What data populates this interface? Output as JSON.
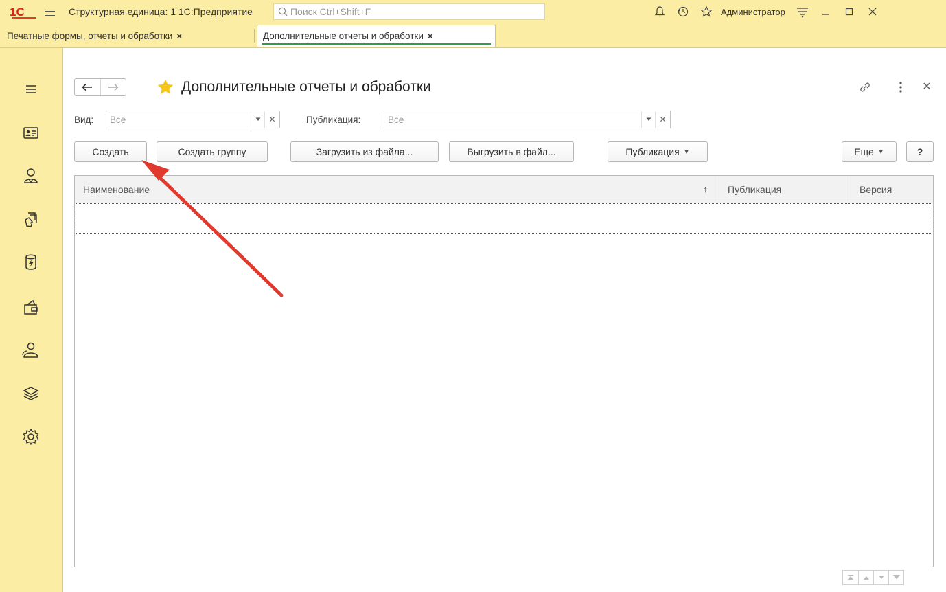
{
  "titlebar": {
    "logo_text": "1С",
    "app_title": "Структурная единица: 1 1С:Предприятие",
    "search_placeholder": "Поиск Ctrl+Shift+F",
    "user": "Администратор",
    "icons": [
      "bell-icon",
      "history-icon",
      "star-outline-icon",
      "settings-lines-icon"
    ],
    "window_controls": [
      "minimize",
      "maximize",
      "close"
    ]
  },
  "tabs": [
    {
      "label": "Печатные формы, отчеты и обработки",
      "close": "×",
      "active": false
    },
    {
      "label": "Дополнительные отчеты и обработки",
      "close": "×",
      "active": true
    }
  ],
  "sidebar": {
    "items": [
      "menu-icon",
      "id-card-icon",
      "person-icon",
      "hand-documents-icon",
      "database-bolt-icon",
      "wallet-icon",
      "group-icon",
      "stack-icon",
      "gear-icon"
    ]
  },
  "page": {
    "title": "Дополнительные отчеты и обработки",
    "filters": {
      "kind_label": "Вид:",
      "kind_value": "Все",
      "publication_label": "Публикация:",
      "publication_value": "Все"
    },
    "toolbar": {
      "create": "Создать",
      "create_group": "Создать группу",
      "load_from_file": "Загрузить из файла...",
      "save_to_file": "Выгрузить в файл...",
      "publication": "Публикация",
      "more": "Еще",
      "help": "?"
    },
    "table": {
      "columns": [
        "Наименование",
        "Публикация",
        "Версия"
      ],
      "sort_indicator": "↑",
      "rows": []
    }
  },
  "colors": {
    "background": "#fbeda4",
    "accent_green": "#2e9b4a",
    "logo_red": "#d9251d",
    "star": "#f5c518",
    "annotation_arrow": "#e0392d"
  }
}
